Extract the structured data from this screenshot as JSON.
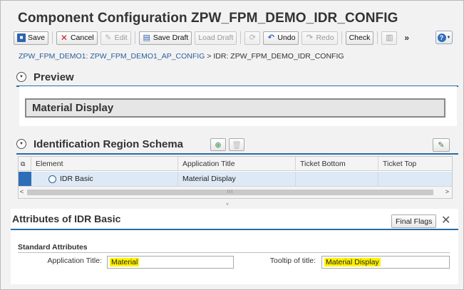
{
  "window": {
    "title": "Component Configuration ZPW_FPM_DEMO_IDR_CONFIG"
  },
  "toolbar": {
    "save": "Save",
    "cancel": "Cancel",
    "edit": "Edit",
    "save_draft": "Save Draft",
    "load_draft": "Load Draft",
    "undo": "Undo",
    "redo": "Redo",
    "check": "Check",
    "more": "»",
    "help": "?"
  },
  "breadcrumb": {
    "link": "ZPW_FPM_DEMO1: ZPW_FPM_DEMO1_AP_CONFIG",
    "separator": ">",
    "current": "IDR: ZPW_FPM_DEMO_IDR_CONFIG"
  },
  "preview": {
    "title": "Preview",
    "application_title": "Material Display"
  },
  "schema": {
    "title": "Identification Region Schema",
    "columns": [
      "Element",
      "Application Title",
      "Ticket Bottom",
      "Ticket Top"
    ],
    "rows": [
      {
        "element": "IDR Basic",
        "application_title": "Material Display",
        "ticket_bottom": "",
        "ticket_top": ""
      }
    ],
    "scroll_left": "<",
    "scroll_right": ">",
    "scroll_grip": "III",
    "splitter": "˅"
  },
  "attributes": {
    "title": "Attributes of IDR Basic",
    "final_flags": "Final Flags",
    "close": "✕",
    "section": "Standard Attributes",
    "application_title_label": "Application Title:",
    "application_title_value": "Material",
    "tooltip_label": "Tooltip of title:",
    "tooltip_value": "Material Display"
  },
  "colors": {
    "accent": "#2b6aa6",
    "highlight": "#fff200",
    "selected_row": "#dde9f5"
  },
  "icons": [
    "save-icon",
    "cancel-icon",
    "edit-icon",
    "save-draft-icon",
    "refresh-icon",
    "undo-icon",
    "redo-icon",
    "layout-icon",
    "help-icon",
    "collapse-icon",
    "add-element-icon",
    "delete-icon",
    "personalize-icon",
    "close-icon"
  ]
}
